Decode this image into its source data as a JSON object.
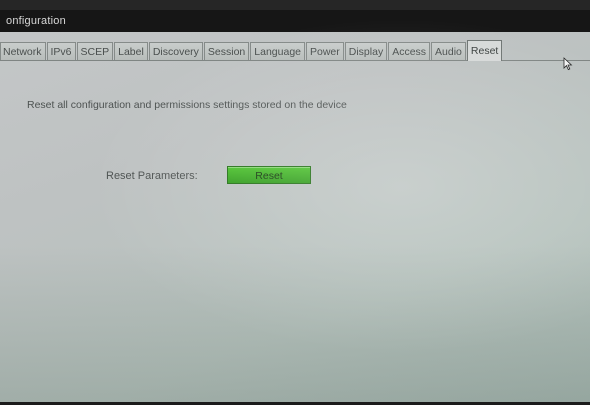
{
  "window": {
    "title": "onfiguration"
  },
  "tabs": [
    {
      "label": "Network"
    },
    {
      "label": "IPv6"
    },
    {
      "label": "SCEP"
    },
    {
      "label": "Label"
    },
    {
      "label": "Discovery"
    },
    {
      "label": "Session"
    },
    {
      "label": "Language"
    },
    {
      "label": "Power"
    },
    {
      "label": "Display"
    },
    {
      "label": "Access"
    },
    {
      "label": "Audio"
    },
    {
      "label": "Reset"
    }
  ],
  "active_tab": "Reset",
  "reset_page": {
    "description": "Reset all configuration and permissions settings stored on the device",
    "parameters_label": "Reset Parameters:",
    "reset_button_label": "Reset"
  },
  "colors": {
    "reset_button": "#3aaf22",
    "title_bar": "#161616",
    "panel_background": "#c0c4c3"
  },
  "icons": {
    "pointer": "mouse-pointer-icon"
  }
}
